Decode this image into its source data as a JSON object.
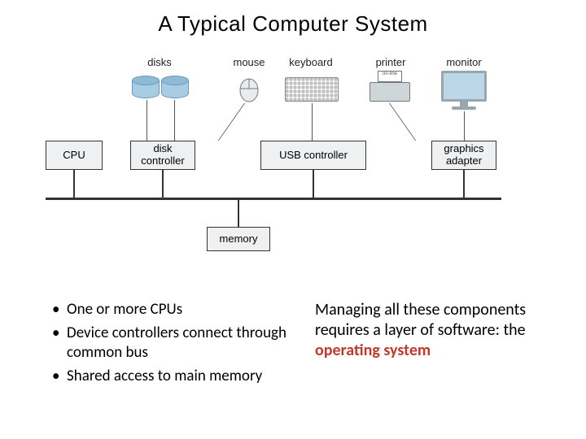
{
  "title": "A Typical Computer System",
  "devices": {
    "disks": "disks",
    "mouse": "mouse",
    "keyboard": "keyboard",
    "printer": "printer",
    "printer_tray": "on-line",
    "monitor": "monitor"
  },
  "controllers": {
    "cpu": "CPU",
    "disk": "disk controller",
    "usb": "USB controller",
    "graphics": "graphics adapter"
  },
  "memory": "memory",
  "bullets": [
    "One or more CPUs",
    "Device controllers connect through common bus",
    "Shared access to main memory"
  ],
  "summary": {
    "prefix": "Managing all these components requires a layer of software: the ",
    "emph": "operating system"
  }
}
